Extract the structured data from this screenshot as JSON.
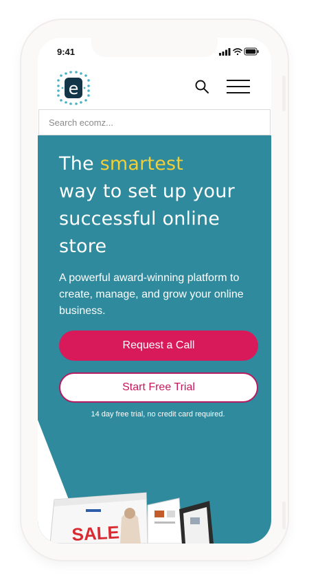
{
  "status_bar": {
    "time": "9:41"
  },
  "header": {
    "logo_letter": "e"
  },
  "search": {
    "placeholder": "Search ecomz..."
  },
  "hero": {
    "title_prefix": "The ",
    "title_accent": "smartest",
    "title_rest": "way to set up your successful online store",
    "subtitle": "A powerful award-winning platform to create, manage, and grow your online business.",
    "primary_cta": "Request a Call",
    "secondary_cta": "Start Free Trial",
    "trial_note": "14 day free trial, no credit card required.",
    "promo_text": "SALE"
  },
  "colors": {
    "brand_teal": "#2e8a9c",
    "accent_yellow": "#f2cf36",
    "cta_pink": "#d81a5b"
  }
}
